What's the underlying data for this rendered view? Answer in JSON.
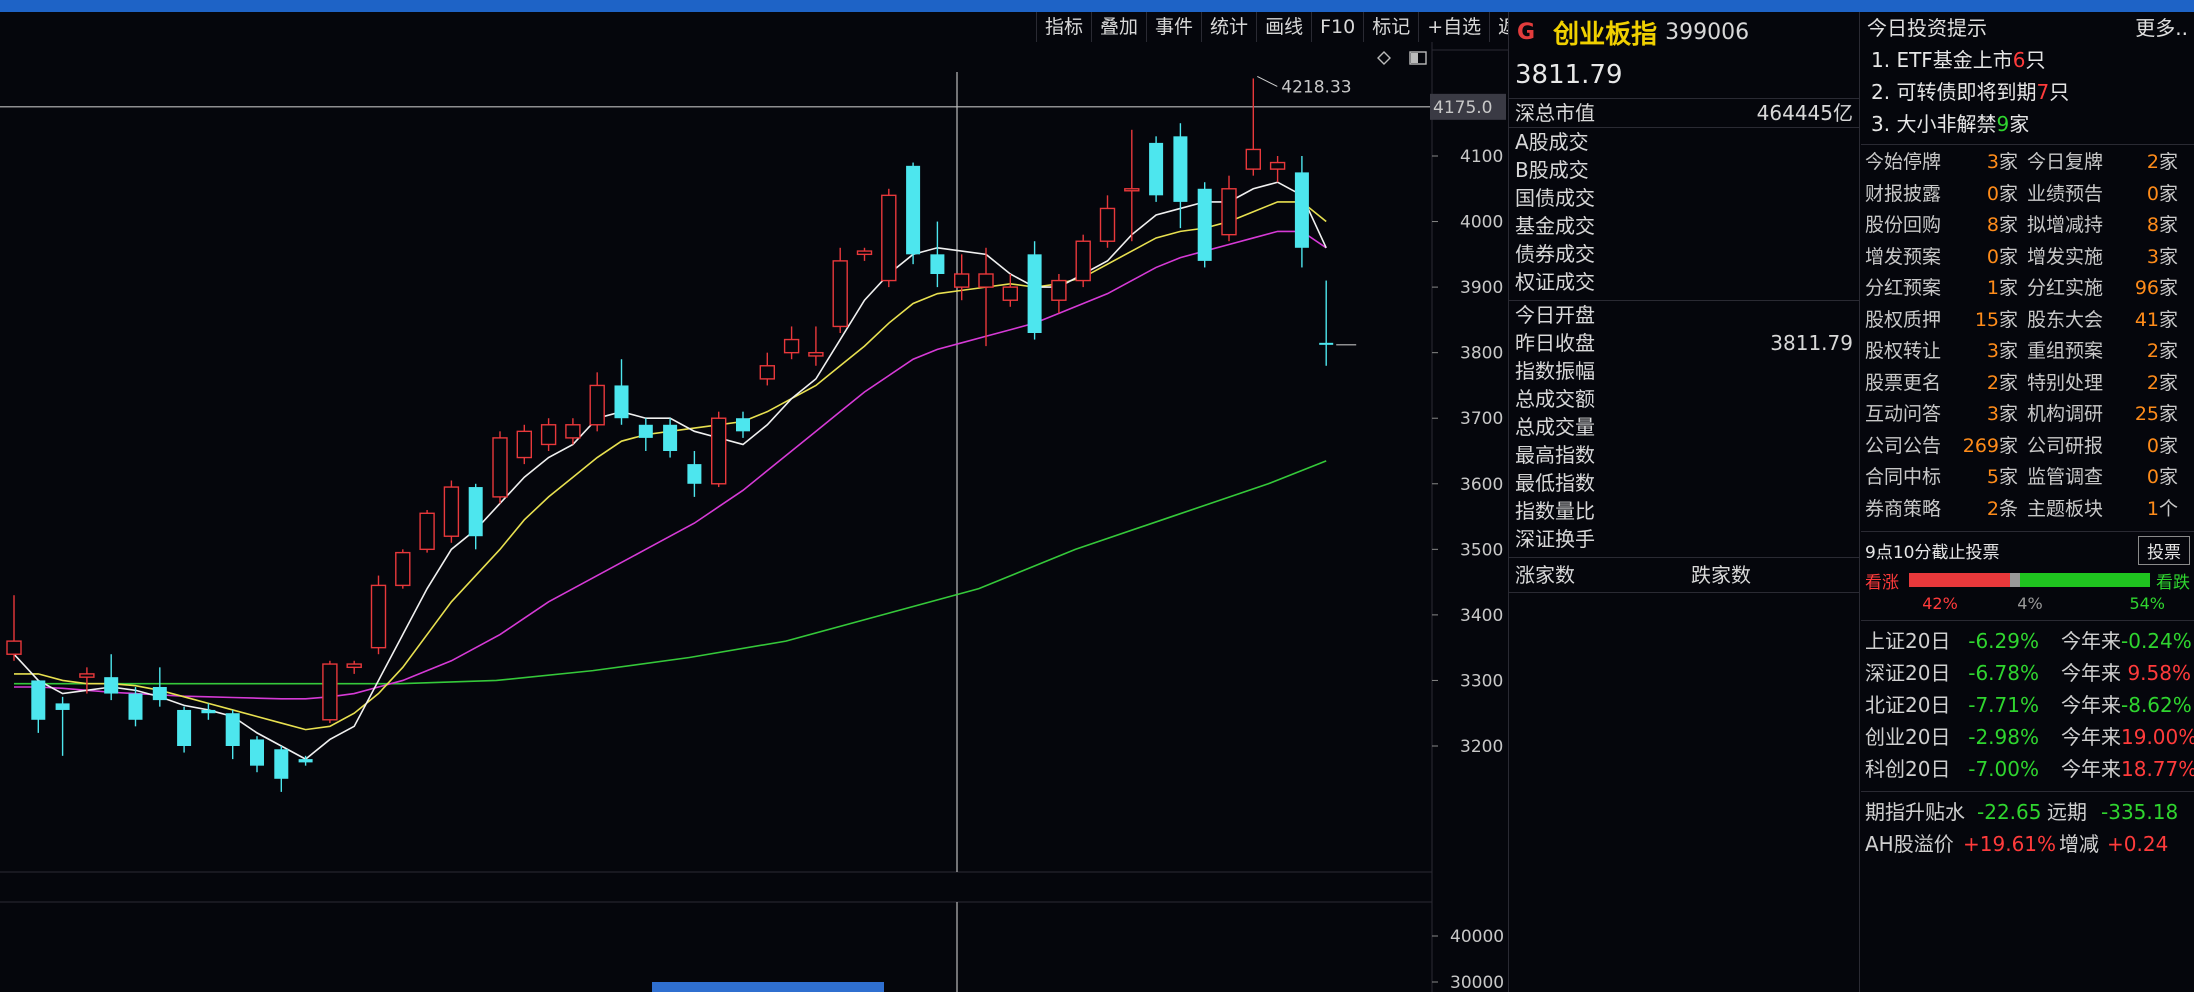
{
  "toolbar": [
    "指标",
    "叠加",
    "事件",
    "统计",
    "画线",
    "F10",
    "标记",
    "+自选",
    "返回"
  ],
  "chart": {
    "price_axis": [
      "4100",
      "4000",
      "3900",
      "3800",
      "3700",
      "3600",
      "3500",
      "3400",
      "3300",
      "3200"
    ],
    "crosshair_price": "4175.0",
    "high_label": "4218.33",
    "volume_axis": [
      "40000",
      "30000"
    ]
  },
  "chart_data": {
    "type": "candlestick",
    "title": "",
    "ylim": [
      3100,
      4230
    ],
    "candles": [
      [
        3340,
        3360,
        3430,
        3330
      ],
      [
        3300,
        3240,
        3300,
        3220
      ],
      [
        3265,
        3255,
        3275,
        3185
      ],
      [
        3305,
        3310,
        3320,
        3280
      ],
      [
        3305,
        3280,
        3340,
        3270
      ],
      [
        3280,
        3240,
        3290,
        3230
      ],
      [
        3290,
        3270,
        3320,
        3260
      ],
      [
        3255,
        3200,
        3260,
        3190
      ],
      [
        3255,
        3250,
        3265,
        3240
      ],
      [
        3250,
        3200,
        3255,
        3180
      ],
      [
        3210,
        3170,
        3215,
        3160
      ],
      [
        3195,
        3150,
        3200,
        3130
      ],
      [
        3180,
        3175,
        3185,
        3170
      ],
      [
        3240,
        3325,
        3330,
        3235
      ],
      [
        3320,
        3325,
        3330,
        3310
      ],
      [
        3350,
        3445,
        3460,
        3340
      ],
      [
        3445,
        3495,
        3500,
        3440
      ],
      [
        3500,
        3555,
        3560,
        3495
      ],
      [
        3520,
        3595,
        3605,
        3510
      ],
      [
        3595,
        3520,
        3600,
        3500
      ],
      [
        3580,
        3670,
        3680,
        3570
      ],
      [
        3640,
        3680,
        3690,
        3630
      ],
      [
        3660,
        3690,
        3700,
        3650
      ],
      [
        3670,
        3690,
        3700,
        3660
      ],
      [
        3690,
        3750,
        3770,
        3680
      ],
      [
        3750,
        3700,
        3790,
        3690
      ],
      [
        3690,
        3670,
        3700,
        3650
      ],
      [
        3690,
        3650,
        3700,
        3640
      ],
      [
        3630,
        3600,
        3650,
        3580
      ],
      [
        3600,
        3700,
        3710,
        3595
      ],
      [
        3700,
        3680,
        3710,
        3670
      ],
      [
        3760,
        3780,
        3800,
        3750
      ],
      [
        3800,
        3820,
        3840,
        3790
      ],
      [
        3795,
        3800,
        3840,
        3780
      ],
      [
        3840,
        3940,
        3960,
        3830
      ],
      [
        3950,
        3955,
        3960,
        3940
      ],
      [
        3910,
        4040,
        4050,
        3900
      ],
      [
        4085,
        3950,
        4090,
        3935
      ],
      [
        3950,
        3920,
        4000,
        3900
      ],
      [
        3900,
        3920,
        3950,
        3880
      ],
      [
        3900,
        3920,
        3960,
        3810
      ],
      [
        3880,
        3900,
        3920,
        3870
      ],
      [
        3950,
        3830,
        3970,
        3820
      ],
      [
        3880,
        3910,
        3920,
        3860
      ],
      [
        3910,
        3970,
        3980,
        3900
      ],
      [
        3970,
        4020,
        4040,
        3960
      ],
      [
        4050,
        4050,
        4140,
        3970
      ],
      [
        4120,
        4040,
        4130,
        4030
      ],
      [
        4130,
        4030,
        4150,
        3990
      ],
      [
        4050,
        3940,
        4060,
        3930
      ],
      [
        3980,
        4050,
        4070,
        3970
      ],
      [
        4080,
        4110,
        4218.33,
        4070
      ],
      [
        4080,
        4090,
        4100,
        4060
      ],
      [
        4075,
        3960,
        4100,
        3930
      ],
      [
        3815,
        3812,
        3910,
        3780
      ]
    ],
    "ma5_label": "",
    "ma_white": [
      3340,
      3300,
      3280,
      3285,
      3290,
      3285,
      3275,
      3262,
      3255,
      3245,
      3220,
      3200,
      3180,
      3210,
      3230,
      3300,
      3370,
      3440,
      3500,
      3530,
      3570,
      3610,
      3640,
      3660,
      3700,
      3710,
      3700,
      3700,
      3680,
      3670,
      3660,
      3690,
      3730,
      3760,
      3820,
      3880,
      3920,
      3950,
      3960,
      3955,
      3950,
      3920,
      3900,
      3900,
      3920,
      3940,
      3980,
      4010,
      4020,
      4030,
      4030,
      4050,
      4060,
      4040,
      3960
    ],
    "ma_yellow": [
      3310,
      3310,
      3300,
      3295,
      3295,
      3292,
      3285,
      3275,
      3265,
      3255,
      3245,
      3235,
      3225,
      3230,
      3250,
      3280,
      3320,
      3370,
      3420,
      3460,
      3500,
      3545,
      3580,
      3610,
      3640,
      3665,
      3675,
      3680,
      3685,
      3690,
      3695,
      3710,
      3730,
      3750,
      3780,
      3810,
      3845,
      3875,
      3890,
      3895,
      3900,
      3905,
      3900,
      3905,
      3915,
      3935,
      3955,
      3975,
      3985,
      3990,
      4000,
      4015,
      4030,
      4030,
      4000
    ],
    "ma_magenta": [
      3290,
      3290,
      3288,
      3285,
      3282,
      3280,
      3278,
      3276,
      3275,
      3274,
      3273,
      3272,
      3272,
      3275,
      3280,
      3290,
      3300,
      3315,
      3330,
      3350,
      3370,
      3395,
      3420,
      3440,
      3460,
      3480,
      3500,
      3520,
      3540,
      3565,
      3590,
      3620,
      3650,
      3680,
      3710,
      3740,
      3765,
      3790,
      3805,
      3815,
      3825,
      3835,
      3845,
      3860,
      3875,
      3890,
      3910,
      3930,
      3945,
      3955,
      3965,
      3975,
      3985,
      3985,
      3960
    ],
    "ma_green_points": [
      [
        0,
        3295
      ],
      [
        20,
        3295
      ],
      [
        25,
        3300
      ],
      [
        30,
        3315
      ],
      [
        35,
        3335
      ],
      [
        40,
        3360
      ],
      [
        45,
        3400
      ],
      [
        50,
        3440
      ],
      [
        55,
        3500
      ],
      [
        60,
        3550
      ],
      [
        65,
        3600
      ],
      [
        68,
        3635
      ]
    ]
  },
  "info": {
    "g": "G",
    "name": "创业板指",
    "code": "399006",
    "price": "3811.79",
    "mkt_cap_label": "深总市值",
    "mkt_cap_value": "464445亿",
    "block1": [
      "A股成交",
      "B股成交",
      "国债成交",
      "基金成交",
      "债券成交",
      "权证成交"
    ],
    "block2": [
      {
        "label": "今日开盘",
        "value": ""
      },
      {
        "label": "昨日收盘",
        "value": "3811.79"
      },
      {
        "label": "指数振幅",
        "value": ""
      },
      {
        "label": "总成交额",
        "value": ""
      },
      {
        "label": "总成交量",
        "value": ""
      },
      {
        "label": "最高指数",
        "value": ""
      },
      {
        "label": "最低指数",
        "value": ""
      },
      {
        "label": "指数量比",
        "value": ""
      },
      {
        "label": "深证换手",
        "value": ""
      }
    ],
    "rise_label": "涨家数",
    "fall_label": "跌家数"
  },
  "right": {
    "title": "今日投资提示",
    "more": "更多..",
    "tips": [
      {
        "pre": "1. ETF基金上市",
        "num": "6",
        "post": "只",
        "color": "red"
      },
      {
        "pre": "2. 可转债即将到期",
        "num": "7",
        "post": "只",
        "color": "red"
      },
      {
        "pre": "3. 大小非解禁",
        "num": "9",
        "post": "家",
        "color": "green"
      }
    ],
    "stats": [
      {
        "l1": "今始停牌",
        "n1": "3",
        "u1": "家",
        "l2": "今日复牌",
        "n2": "2",
        "u2": "家"
      },
      {
        "l1": "财报披露",
        "n1": "0",
        "u1": "家",
        "l2": "业绩预告",
        "n2": "0",
        "u2": "家"
      },
      {
        "l1": "股份回购",
        "n1": "8",
        "u1": "家",
        "l2": "拟增减持",
        "n2": "8",
        "u2": "家"
      },
      {
        "l1": "增发预案",
        "n1": "0",
        "u1": "家",
        "l2": "增发实施",
        "n2": "3",
        "u2": "家"
      },
      {
        "l1": "分红预案",
        "n1": "1",
        "u1": "家",
        "l2": "分红实施",
        "n2": "96",
        "u2": "家"
      },
      {
        "l1": "股权质押",
        "n1": "15",
        "u1": "家",
        "l2": "股东大会",
        "n2": "41",
        "u2": "家"
      },
      {
        "l1": "股权转让",
        "n1": "3",
        "u1": "家",
        "l2": "重组预案",
        "n2": "2",
        "u2": "家"
      },
      {
        "l1": "股票更名",
        "n1": "2",
        "u1": "家",
        "l2": "特别处理",
        "n2": "2",
        "u2": "家"
      },
      {
        "l1": "互动问答",
        "n1": "3",
        "u1": "家",
        "l2": "机构调研",
        "n2": "25",
        "u2": "家"
      },
      {
        "l1": "公司公告",
        "n1": "269",
        "u1": "家",
        "l2": "公司研报",
        "n2": "0",
        "u2": "家"
      },
      {
        "l1": "合同中标",
        "n1": "5",
        "u1": "家",
        "l2": "监管调查",
        "n2": "0",
        "u2": "家"
      },
      {
        "l1": "券商策略",
        "n1": "2",
        "u1": "条",
        "l2": "主题板块",
        "n2": "1",
        "u2": "个"
      }
    ],
    "vote_title": "9点10分截止投票",
    "vote_button": "投票",
    "bull_label": "看涨",
    "bear_label": "看跌",
    "bull_pct_text": "42%",
    "neutral_pct_text": "4%",
    "bear_pct_text": "54%",
    "bull_pct": 42,
    "neutral_pct": 4,
    "bear_pct": 54,
    "perf": [
      {
        "l1": "上证20日",
        "v1": "-6.29%",
        "l2": "今年来",
        "v2": "-0.24%",
        "c2": "green"
      },
      {
        "l1": "深证20日",
        "v1": "-6.78%",
        "l2": "今年来",
        "v2": "9.58%",
        "c2": "red"
      },
      {
        "l1": "北证20日",
        "v1": "-7.71%",
        "l2": "今年来",
        "v2": "-8.62%",
        "c2": "green"
      },
      {
        "l1": "创业20日",
        "v1": "-2.98%",
        "l2": "今年来",
        "v2": "19.00%",
        "c2": "red"
      },
      {
        "l1": "科创20日",
        "v1": "-7.00%",
        "l2": "今年来",
        "v2": "18.77%",
        "c2": "red"
      }
    ],
    "futures_label": "期指升贴水",
    "futures_value": "-22.65",
    "far_label": "远期",
    "far_value": "-335.18",
    "ah_label": "AH股溢价",
    "ah_value": "+19.61%",
    "ah_change_label": "增减",
    "ah_change_value": "+0.24"
  }
}
